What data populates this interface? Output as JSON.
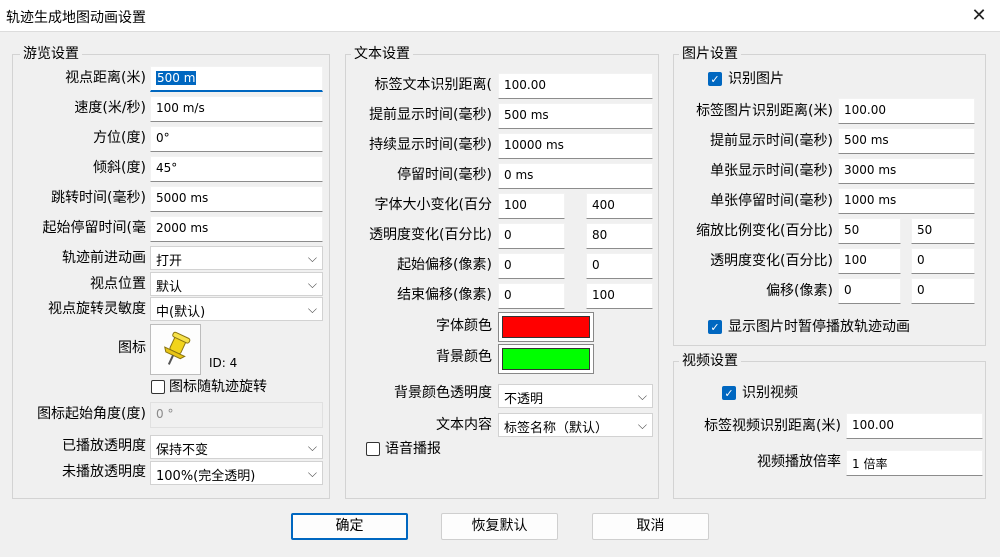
{
  "window": {
    "title": "轨迹生成地图动画设置"
  },
  "browse": {
    "title": "游览设置",
    "view_distance": {
      "label": "视点距离(米)",
      "value": "500 m"
    },
    "speed": {
      "label": "速度(米/秒)",
      "value": "100 m/s"
    },
    "azimuth": {
      "label": "方位(度)",
      "value": "0°"
    },
    "tilt": {
      "label": "倾斜(度)",
      "value": "45°"
    },
    "jump_time": {
      "label": "跳转时间(毫秒)",
      "value": "5000 ms"
    },
    "start_stay": {
      "label": "起始停留时间(毫",
      "value": "2000 ms"
    },
    "pre_anim": {
      "label": "轨迹前进动画",
      "value": "打开"
    },
    "view_pos": {
      "label": "视点位置",
      "value": "默认"
    },
    "rot_sens": {
      "label": "视点旋转灵敏度",
      "value": "中(默认)"
    },
    "icon": {
      "label": "图标",
      "id_text": "ID: 4"
    },
    "icon_rotate": {
      "label": "图标随轨迹旋转",
      "checked": false
    },
    "icon_start_angle": {
      "label": "图标起始角度(度)",
      "value": "0 °"
    },
    "played_opacity": {
      "label": "已播放透明度",
      "value": "保持不变"
    },
    "unplayed_opacity": {
      "label": "未播放透明度",
      "value": "100%(完全透明)"
    }
  },
  "text": {
    "title": "文本设置",
    "label_dist": {
      "label": "标签文本识别距离(",
      "value": "100.00"
    },
    "early_time": {
      "label": "提前显示时间(毫秒)",
      "value": "500 ms"
    },
    "duration": {
      "label": "持续显示时间(毫秒)",
      "value": "10000 ms"
    },
    "stay_time": {
      "label": "停留时间(毫秒)",
      "value": "0 ms"
    },
    "font_size_change": {
      "label": "字体大小变化(百分",
      "from": "100",
      "to": "400"
    },
    "opacity_change": {
      "label": "透明度变化(百分比)",
      "from": "0",
      "to": "80"
    },
    "start_offset": {
      "label": "起始偏移(像素)",
      "from": "0",
      "to": "0"
    },
    "end_offset": {
      "label": "结束偏移(像素)",
      "from": "0",
      "to": "100"
    },
    "font_color": {
      "label": "字体颜色",
      "color": "#ff0000"
    },
    "bg_color": {
      "label": "背景颜色",
      "color": "#00ff00"
    },
    "bg_opacity": {
      "label": "背景颜色透明度",
      "value": "不透明"
    },
    "content": {
      "label": "文本内容",
      "value": "标签名称（默认）"
    },
    "voice": {
      "label": "语音播报",
      "checked": false
    }
  },
  "image": {
    "title": "图片设置",
    "recognize": {
      "label": "识别图片",
      "checked": true
    },
    "label_dist": {
      "label": "标签图片识别距离(米)",
      "value": "100.00"
    },
    "early_time": {
      "label": "提前显示时间(毫秒)",
      "value": "500 ms"
    },
    "single_time": {
      "label": "单张显示时间(毫秒)",
      "value": "3000 ms"
    },
    "single_stay": {
      "label": "单张停留时间(毫秒)",
      "value": "1000 ms"
    },
    "scale_change": {
      "label": "缩放比例变化(百分比)",
      "from": "50",
      "to": "50"
    },
    "opacity_change": {
      "label": "透明度变化(百分比)",
      "from": "100",
      "to": "0"
    },
    "offset": {
      "label": "偏移(像素)",
      "from": "0",
      "to": "0"
    },
    "pause_anim": {
      "label": "显示图片时暂停播放轨迹动画",
      "checked": true
    }
  },
  "video": {
    "title": "视频设置",
    "recognize": {
      "label": "识别视频",
      "checked": true
    },
    "label_dist": {
      "label": "标签视频识别距离(米)",
      "value": "100.00"
    },
    "speed": {
      "label": "视频播放倍率",
      "value": "1 倍率"
    }
  },
  "buttons": {
    "ok": "确定",
    "reset": "恢复默认",
    "cancel": "取消"
  },
  "colors": {
    "accent": "#0067c0",
    "font_red": "#ff0000",
    "bg_green": "#00ff00",
    "pin_yellow": "#f2d41c"
  }
}
